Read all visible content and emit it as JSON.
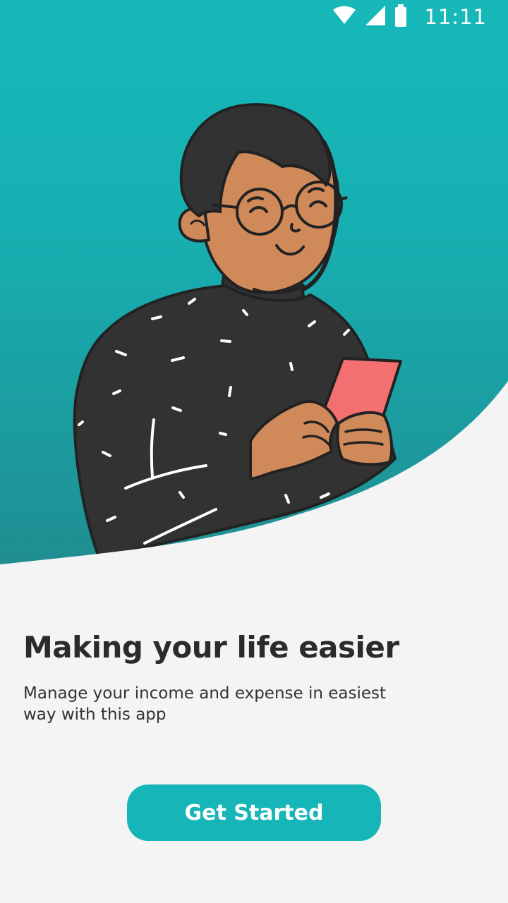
{
  "status_bar": {
    "time": "11:11",
    "icons": [
      "wifi-icon",
      "cellular-signal-icon",
      "battery-icon"
    ]
  },
  "onboarding": {
    "title": "Making your life easier",
    "description": "Manage your income and expense in easiest way with this app",
    "cta_label": "Get Started"
  },
  "illustration": {
    "subject": "man-with-glasses-holding-phone-illustration"
  },
  "colors": {
    "accent": "#16b5b7",
    "hero_gradient_top": "#16b8b9",
    "hero_gradient_bottom": "#1f8f93",
    "background": "#f4f4f4",
    "text_primary": "#2b2b2b",
    "sweater": "#323232",
    "skin": "#d08a5a",
    "phone": "#f46f70"
  }
}
